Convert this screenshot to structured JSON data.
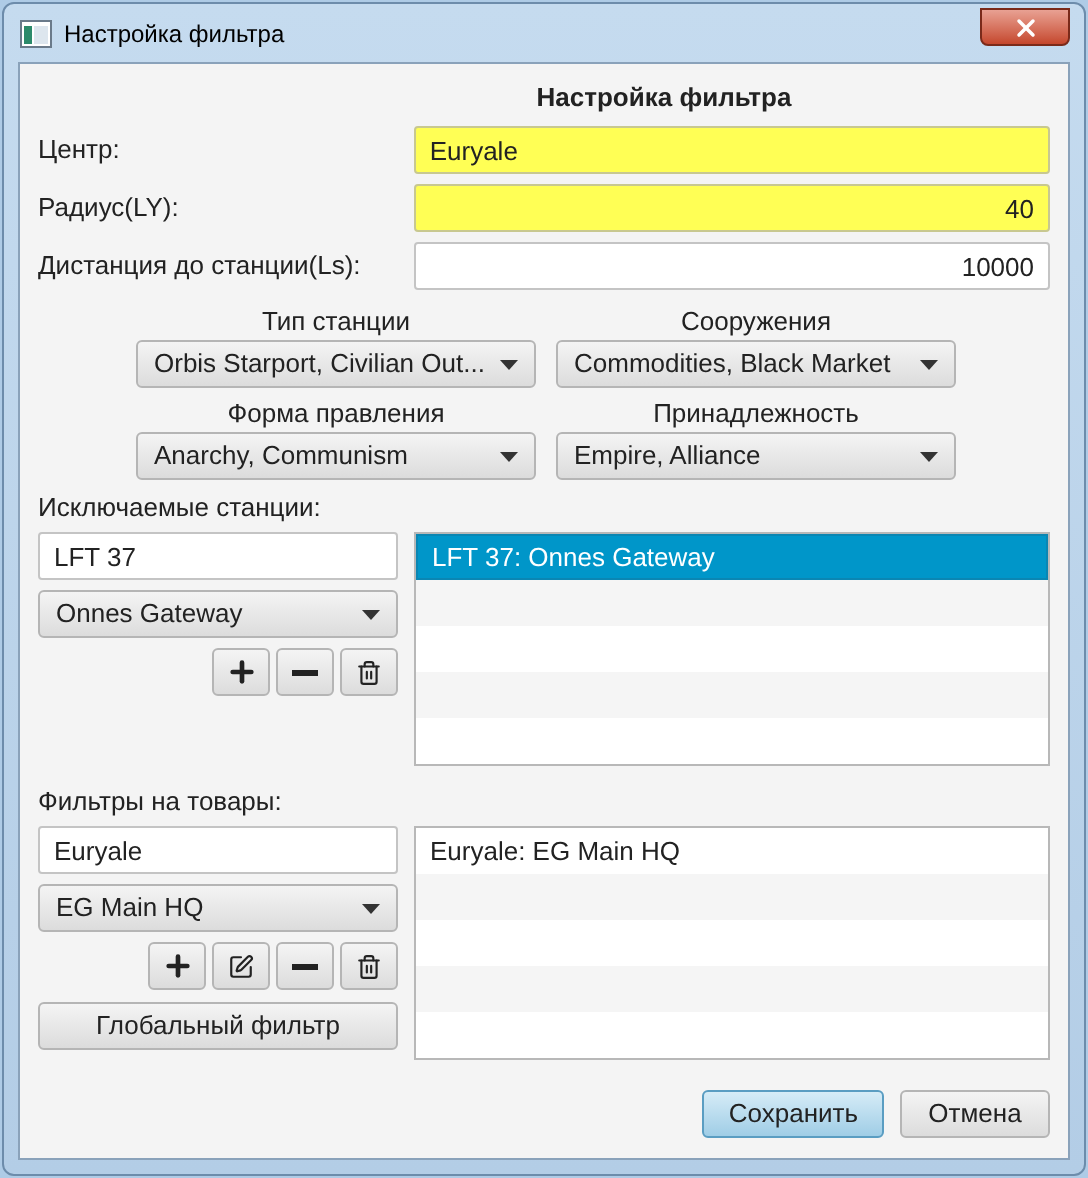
{
  "window": {
    "title": "Настройка фильтра"
  },
  "heading": "Настройка фильтра",
  "fields": [
    {
      "label": "Центр:",
      "value": "Euryale",
      "highlighted": true
    },
    {
      "label": "Радиус(LY):",
      "value": "40",
      "highlighted": true
    },
    {
      "label": "Дистанция до станции(Ls):",
      "value": "10000",
      "highlighted": false
    }
  ],
  "selectors": [
    {
      "label": "Тип станции",
      "value": "Orbis Starport, Civilian Out..."
    },
    {
      "label": "Сооружения",
      "value": "Commodities, Black Market"
    },
    {
      "label": "Форма правления",
      "value": "Anarchy, Communism"
    },
    {
      "label": "Принадлежность",
      "value": "Empire, Alliance"
    }
  ],
  "sections": [
    {
      "label": "Исключаемые станции:",
      "input": "LFT 37",
      "dropdown": "Onnes Gateway",
      "tools": [
        {
          "kind": "add"
        },
        {
          "kind": "remove"
        },
        {
          "kind": "clear"
        }
      ],
      "items": [
        {
          "text": "LFT 37: Onnes Gateway",
          "selected": true
        }
      ]
    },
    {
      "label": "Фильтры на товары:",
      "input": "Euryale",
      "dropdown": "EG Main HQ",
      "tools": [
        {
          "kind": "add"
        },
        {
          "kind": "edit"
        },
        {
          "kind": "remove"
        },
        {
          "kind": "clear"
        }
      ],
      "extra_button": "Глобальный фильтр",
      "items": [
        {
          "text": "Euryale: EG Main HQ",
          "selected": false
        }
      ]
    }
  ],
  "buttons": [
    {
      "label": "Сохранить",
      "default": true
    },
    {
      "label": "Отмена",
      "default": false
    }
  ]
}
